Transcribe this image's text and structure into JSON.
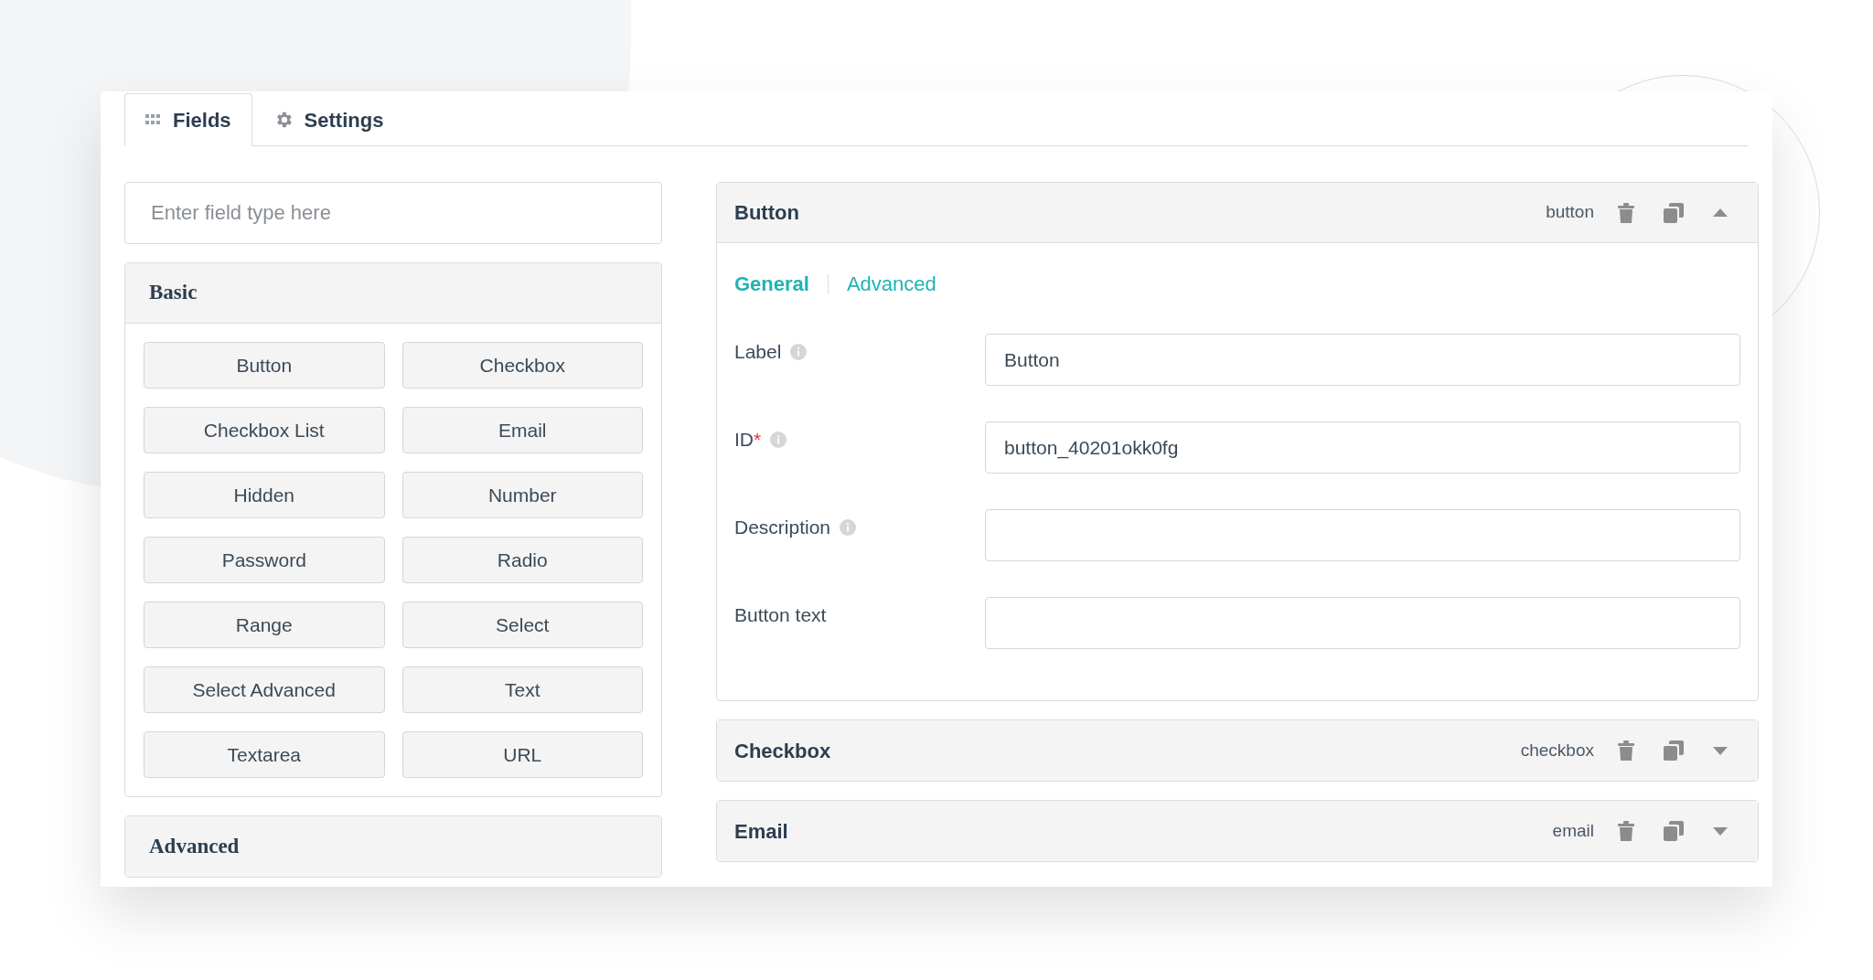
{
  "tabs": [
    {
      "label": "Fields",
      "kind": "grid",
      "selected": true
    },
    {
      "label": "Settings",
      "kind": "gear",
      "selected": false
    }
  ],
  "search": {
    "placeholder": "Enter field type here"
  },
  "groups": [
    {
      "title": "Basic",
      "expanded": true,
      "items": [
        "Button",
        "Checkbox",
        "Checkbox List",
        "Email",
        "Hidden",
        "Number",
        "Password",
        "Radio",
        "Range",
        "Select",
        "Select Advanced",
        "Text",
        "Textarea",
        "URL"
      ]
    },
    {
      "title": "Advanced",
      "expanded": false
    }
  ],
  "fields": [
    {
      "title": "Button",
      "type": "button",
      "expanded": true,
      "subtabs": [
        {
          "label": "General",
          "selected": true
        },
        {
          "label": "Advanced",
          "selected": false
        }
      ],
      "rows": [
        {
          "label": "Label",
          "required_mark": "",
          "info": true,
          "value": "Button"
        },
        {
          "label": "ID",
          "required_mark": "*",
          "info": true,
          "value": "button_40201okk0fg"
        },
        {
          "label": "Description",
          "required_mark": "",
          "info": true,
          "value": ""
        },
        {
          "label": "Button text",
          "required_mark": "",
          "info": false,
          "value": ""
        }
      ]
    },
    {
      "title": "Checkbox",
      "type": "checkbox",
      "expanded": false
    },
    {
      "title": "Email",
      "type": "email",
      "expanded": false
    }
  ]
}
